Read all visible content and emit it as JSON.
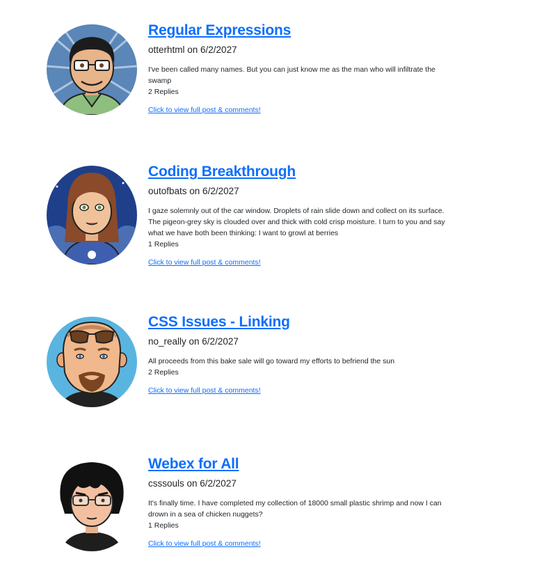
{
  "posts": [
    {
      "title": "Regular Expressions",
      "author": "otterhtml",
      "date": "6/2/2027",
      "byline": "otterhtml on 6/2/2027",
      "body": "I've been called many names. But you can just know me as the man who will infiltrate the swamp",
      "replies": "2 Replies",
      "link_label": "Click to view full post & comments!",
      "avatar_icon": "man-glasses-avatar-icon"
    },
    {
      "title": "Coding Breakthrough",
      "author": "outofbats",
      "date": "6/2/2027",
      "byline": "outofbats on 6/2/2027",
      "body": "I gaze solemnly out of the car window. Droplets of rain slide down and collect on its surface. The pigeon-grey sky is clouded over and thick with cold crisp moisture. I turn to you and say what we have both been thinking: I want to growl at berries",
      "replies": "1 Replies",
      "link_label": "Click to view full post & comments!",
      "avatar_icon": "woman-avatar-icon"
    },
    {
      "title": "CSS Issues - Linking",
      "author": "no_really",
      "date": "6/2/2027",
      "byline": "no_really on 6/2/2027",
      "body": "All proceeds from this bake sale will go toward my efforts to befriend the sun",
      "replies": "2 Replies",
      "link_label": "Click to view full post & comments!",
      "avatar_icon": "man-sunglasses-goatee-avatar-icon"
    },
    {
      "title": "Webex for All",
      "author": "csssouls",
      "date": "6/2/2027",
      "byline": "csssouls on 6/2/2027",
      "body": "It's finally time. I have completed my collection of 18000 small plastic shrimp and now I can drown in a sea of chicken nuggets?",
      "replies": "1 Replies",
      "link_label": "Click to view full post & comments!",
      "avatar_icon": "man-black-hair-glasses-avatar-icon"
    }
  ],
  "colors": {
    "link": "#0d6efd",
    "text": "#212529",
    "background": "#ffffff"
  }
}
